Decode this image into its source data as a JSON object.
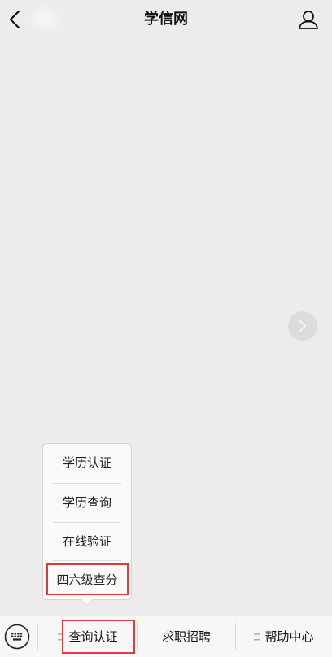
{
  "header": {
    "title": "学信网"
  },
  "popup": {
    "items": [
      {
        "label": "学历认证"
      },
      {
        "label": "学历查询"
      },
      {
        "label": "在线验证"
      },
      {
        "label": "四六级查分"
      }
    ]
  },
  "bottom_menu": {
    "items": [
      {
        "label": "查询认证"
      },
      {
        "label": "求职招聘"
      },
      {
        "label": "帮助中心"
      }
    ]
  },
  "colors": {
    "background": "#ececec",
    "highlight": "#e03a3a"
  },
  "icons": [
    "chevron-left-icon",
    "user-icon",
    "chevron-right-icon",
    "keyboard-icon",
    "menu-lines-icon"
  ]
}
